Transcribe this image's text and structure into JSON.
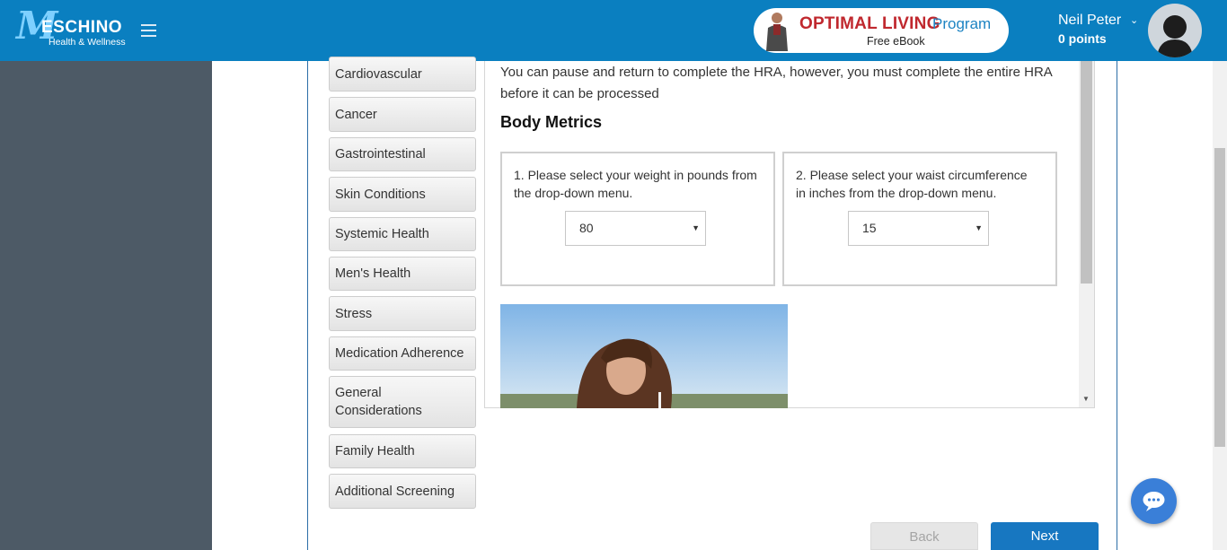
{
  "header": {
    "logo_brand": "ESCHINO",
    "logo_tagline": "Health & Wellness",
    "ebook_title": "OPTIMAL LIVING",
    "ebook_program": "Program",
    "ebook_subtitle": "Free eBook",
    "user_name": "Neil Peter",
    "user_points": "0 points"
  },
  "categories": [
    "Cardiovascular",
    "Cancer",
    "Gastrointestinal",
    "Skin Conditions",
    "Systemic Health",
    "Men's Health",
    "Stress",
    "Medication Adherence",
    "General Considerations",
    "Family Health",
    "Additional Screening"
  ],
  "content": {
    "intro": "You can pause and return to complete the HRA, however, you must complete the entire HRA before it can be processed",
    "section_title": "Body Metrics",
    "questions": [
      {
        "text": "1.   Please select your weight in pounds from the drop-down menu.",
        "selected": "80"
      },
      {
        "text": "2.   Please select your waist circumference in inches from the drop-down menu.",
        "selected": "15"
      }
    ]
  },
  "nav": {
    "back_label": "Back",
    "next_label": "Next"
  },
  "colors": {
    "header": "#0a7fc0",
    "sidebar": "#4d5a66",
    "next_button": "#1777c1",
    "chat_button": "#3a7fd8"
  }
}
